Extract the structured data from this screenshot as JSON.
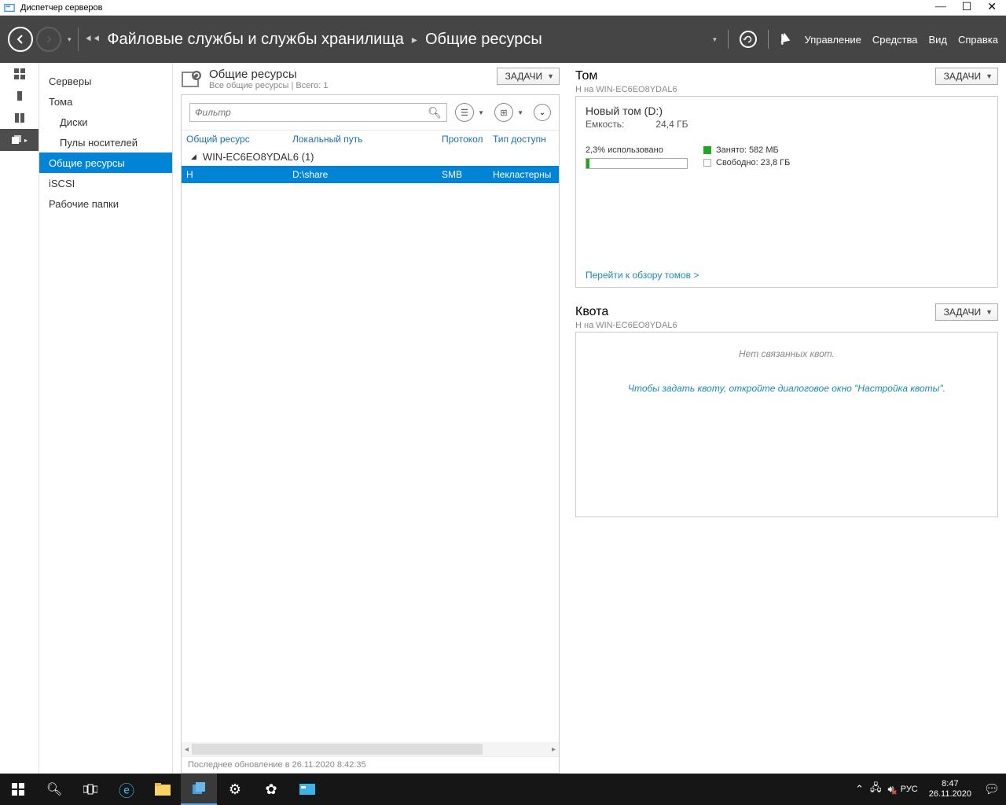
{
  "window": {
    "title": "Диспетчер серверов"
  },
  "header": {
    "breadcrumb_prefix": "⯇⯇",
    "breadcrumb1": "Файловые службы и службы хранилища",
    "breadcrumb2": "Общие ресурсы",
    "menu": {
      "manage": "Управление",
      "tools": "Средства",
      "view": "Вид",
      "help": "Справка"
    }
  },
  "sidebar": {
    "items": [
      {
        "label": "Серверы"
      },
      {
        "label": "Тома"
      },
      {
        "label": "Диски"
      },
      {
        "label": "Пулы носителей"
      },
      {
        "label": "Общие ресурсы"
      },
      {
        "label": "iSCSI"
      },
      {
        "label": "Рабочие папки"
      }
    ]
  },
  "shares_panel": {
    "title": "Общие ресурсы",
    "subtitle": "Все общие ресурсы | Всего: 1",
    "tasks_label": "ЗАДАЧИ",
    "filter_placeholder": "Фильтр",
    "columns": {
      "share": "Общий ресурс",
      "local_path": "Локальный путь",
      "protocol": "Протокол",
      "access_type": "Тип доступн"
    },
    "group_label": "WIN-EC6EO8YDAL6 (1)",
    "rows": [
      {
        "name": "H",
        "path": "D:\\share",
        "protocol": "SMB",
        "access": "Некластерны"
      }
    ],
    "last_update": "Последнее обновление в 26.11.2020 8:42:35"
  },
  "volume_panel": {
    "title": "Том",
    "subtitle": "H на WIN-EC6EO8YDAL6",
    "tasks_label": "ЗАДАЧИ",
    "vol_name": "Новый том (D:)",
    "capacity_label": "Емкость:",
    "capacity_value": "24,4 ГБ",
    "used_text": "2,3% использовано",
    "legend_used": "Занято: 582 МБ",
    "legend_free": "Свободно: 23,8 ГБ",
    "link": "Перейти к обзору томов >"
  },
  "quota_panel": {
    "title": "Квота",
    "subtitle": "H на WIN-EC6EO8YDAL6",
    "tasks_label": "ЗАДАЧИ",
    "empty_text": "Нет связанных квот.",
    "hint_text": "Чтобы задать квоту, откройте диалоговое окно \"Настройка квоты\"."
  },
  "taskbar": {
    "lang": "РУС",
    "time": "8:47",
    "date": "26.11.2020"
  }
}
